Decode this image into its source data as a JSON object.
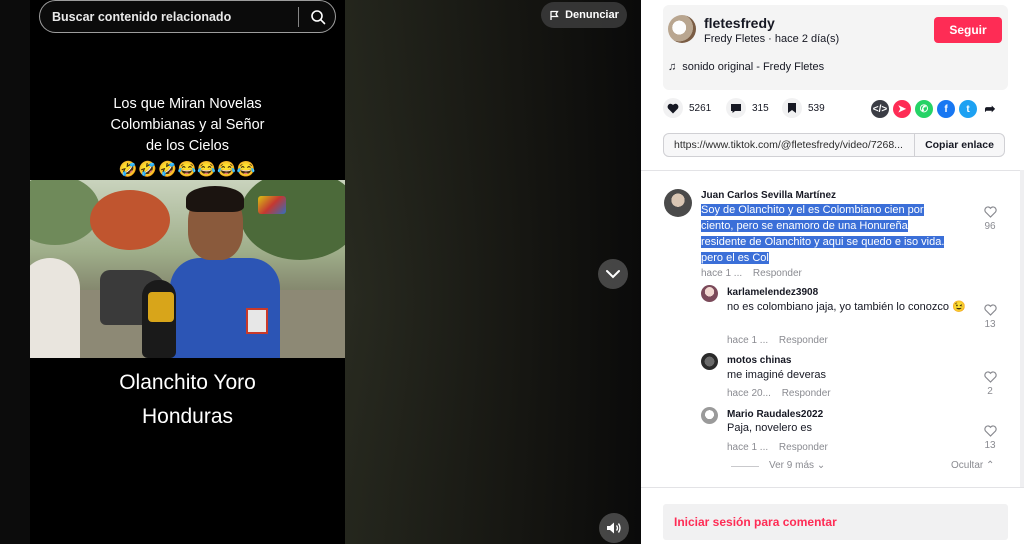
{
  "search": {
    "placeholder": "Buscar contenido relacionado"
  },
  "report": {
    "label": "Denunciar"
  },
  "video": {
    "caption_lines": [
      "Los que Miran Novelas",
      "Colombianas y al Señor",
      "de los Cielos"
    ],
    "emojis": "🤣🤣🤣😂😂😂😂",
    "big_lines": [
      "Olanchito Yoro",
      "Honduras"
    ]
  },
  "author": {
    "username": "fletesfredy",
    "subline": "Fredy Fletes · hace 2 día(s)",
    "follow_label": "Seguir",
    "sound": "sonido original - Fredy Fletes"
  },
  "stats": {
    "likes": "5261",
    "comments": "315",
    "saves": "539"
  },
  "share": {
    "url": "https://www.tiktok.com/@fletesfredy/video/7268...",
    "copy_label": "Copiar enlace"
  },
  "comments": [
    {
      "name": "Juan Carlos Sevilla Martínez",
      "text_lines": [
        "Soy de Olanchito y el es Colombiano cien por",
        "ciento, pero se enamoro de una Honureña",
        "residente de Olanchito y aqui se quedo e iso vida.",
        "pero el es Col"
      ],
      "time": "hace 1 ...",
      "reply": "Responder",
      "likes": "96"
    },
    {
      "name": "karlamelendez3908",
      "text": "no es colombiano jaja, yo también lo conozco 😉",
      "time": "hace 1 ...",
      "reply": "Responder",
      "likes": "13"
    },
    {
      "name": "motos chinas",
      "text": "me imaginé deveras",
      "time": "hace 20...",
      "reply": "Responder",
      "likes": "2"
    },
    {
      "name": "Mario Raudales2022",
      "text": "Paja, novelero es",
      "time": "hace 1 ...",
      "reply": "Responder",
      "likes": "13"
    }
  ],
  "thread": {
    "more": "Ver 9 más",
    "hide": "Ocultar"
  },
  "login": {
    "label": "Iniciar sesión para comentar"
  },
  "colors": {
    "accent": "#fe2c55",
    "selection": "#3b6fd8"
  }
}
